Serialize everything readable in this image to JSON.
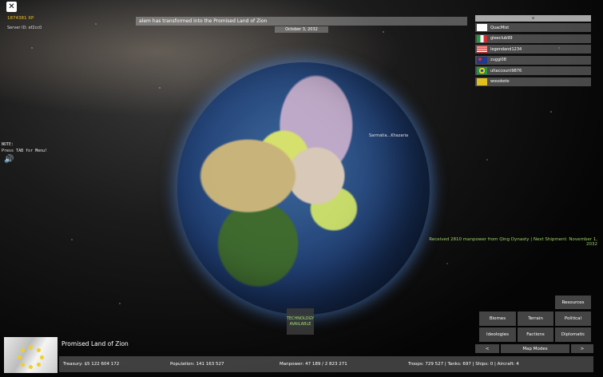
{
  "top_left": {
    "close_label": "✕",
    "xp": "1874381 XP",
    "server_id": "Server ID: ef2cc0"
  },
  "note": {
    "line1": "NOTE:",
    "line2": "Press TAB for Menu!"
  },
  "banner": {
    "text": "alem has transformed into the Promised Land of Zion",
    "date": "October 3, 2032"
  },
  "globe": {
    "label": "Sarmatia...Khazaria"
  },
  "players": {
    "toggle": "v",
    "list": [
      {
        "name": "QuacMist",
        "flag": "blank"
      },
      {
        "name": "gleeclub99",
        "flag": "italy"
      },
      {
        "name": "legendand1234",
        "flag": "usa"
      },
      {
        "name": "zuggi08",
        "flag": "australia"
      },
      {
        "name": "ultaccount9876",
        "flag": "brazil"
      },
      {
        "name": "wosokoto",
        "flag": "yellow"
      }
    ]
  },
  "notification": "Received 2810 manpower from Qing Dynasty | Next Shipment: November 1, 2032",
  "tech_button": {
    "line1": "TECHNOLOGY",
    "line2": "AVAILABLE"
  },
  "map_modes": {
    "resources": "Resources",
    "biomes": "Biomes",
    "terrain": "Terrain",
    "political": "Political",
    "ideologies": "Ideologies",
    "factions": "Factions",
    "diplomatic": "Diplomatic",
    "prev": "<",
    "title": "Map Modes",
    "next": ">"
  },
  "nation": {
    "name": "Promised Land of Zion"
  },
  "stats": {
    "treasury": "Treasury:   $5 122 604 172",
    "population": "Population: 141 163 527",
    "manpower": "Manpower:  47 189  /  2 823 271",
    "troops": "Troops: 729 527  |  Tanks: 697  |  Ships: 0  |  Aircraft: 4"
  },
  "colors": {
    "xp": "#f0c020",
    "notification": "#9ed26a",
    "tech": "#9fe070"
  }
}
